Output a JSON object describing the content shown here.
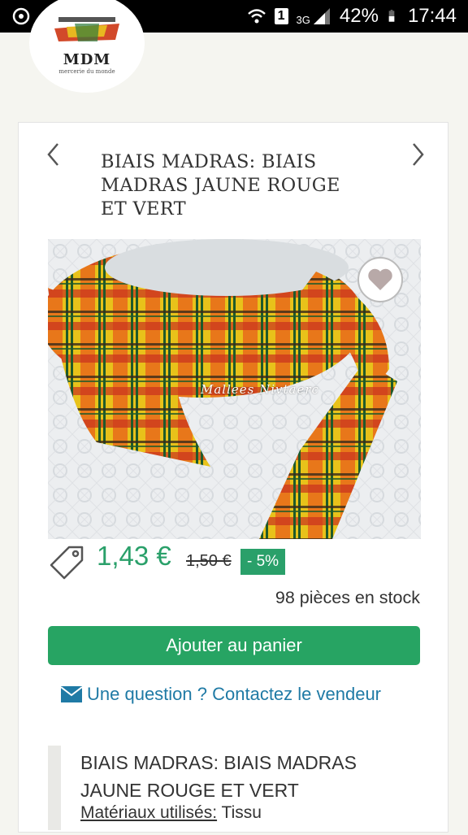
{
  "status_bar": {
    "sim": "1",
    "network": "3G",
    "battery": "42%",
    "time": "17:44"
  },
  "logo": {
    "text": "MDM",
    "subtitle": "mercerie du monde"
  },
  "product": {
    "title": "BIAIS MADRAS: BIAIS MADRAS JAUNE ROUGE ET VERT",
    "watermark": "Mallees  Nivtaerc",
    "price": "1,43 €",
    "old_price": "1,50 €",
    "discount": "- 5%",
    "stock": "98 pièces en stock",
    "add_to_cart": "Ajouter au panier",
    "contact": "Une question ? Contactez le vendeur"
  },
  "description": {
    "title": "BIAIS MADRAS: BIAIS MADRAS JAUNE ROUGE ET VERT",
    "materials_label": "Matériaux utilisés:",
    "materials_value": " Tissu"
  },
  "colors": {
    "accent_green": "#27a463",
    "price_green": "#2aa06a",
    "link_blue": "#1f7aa5"
  },
  "icons": [
    "alarm-icon",
    "voicemail-icon",
    "mail-icon",
    "wifi-icon",
    "signal-icon",
    "battery-icon",
    "chevron-left-icon",
    "chevron-right-icon",
    "heart-icon",
    "price-tag-icon",
    "envelope-icon"
  ]
}
